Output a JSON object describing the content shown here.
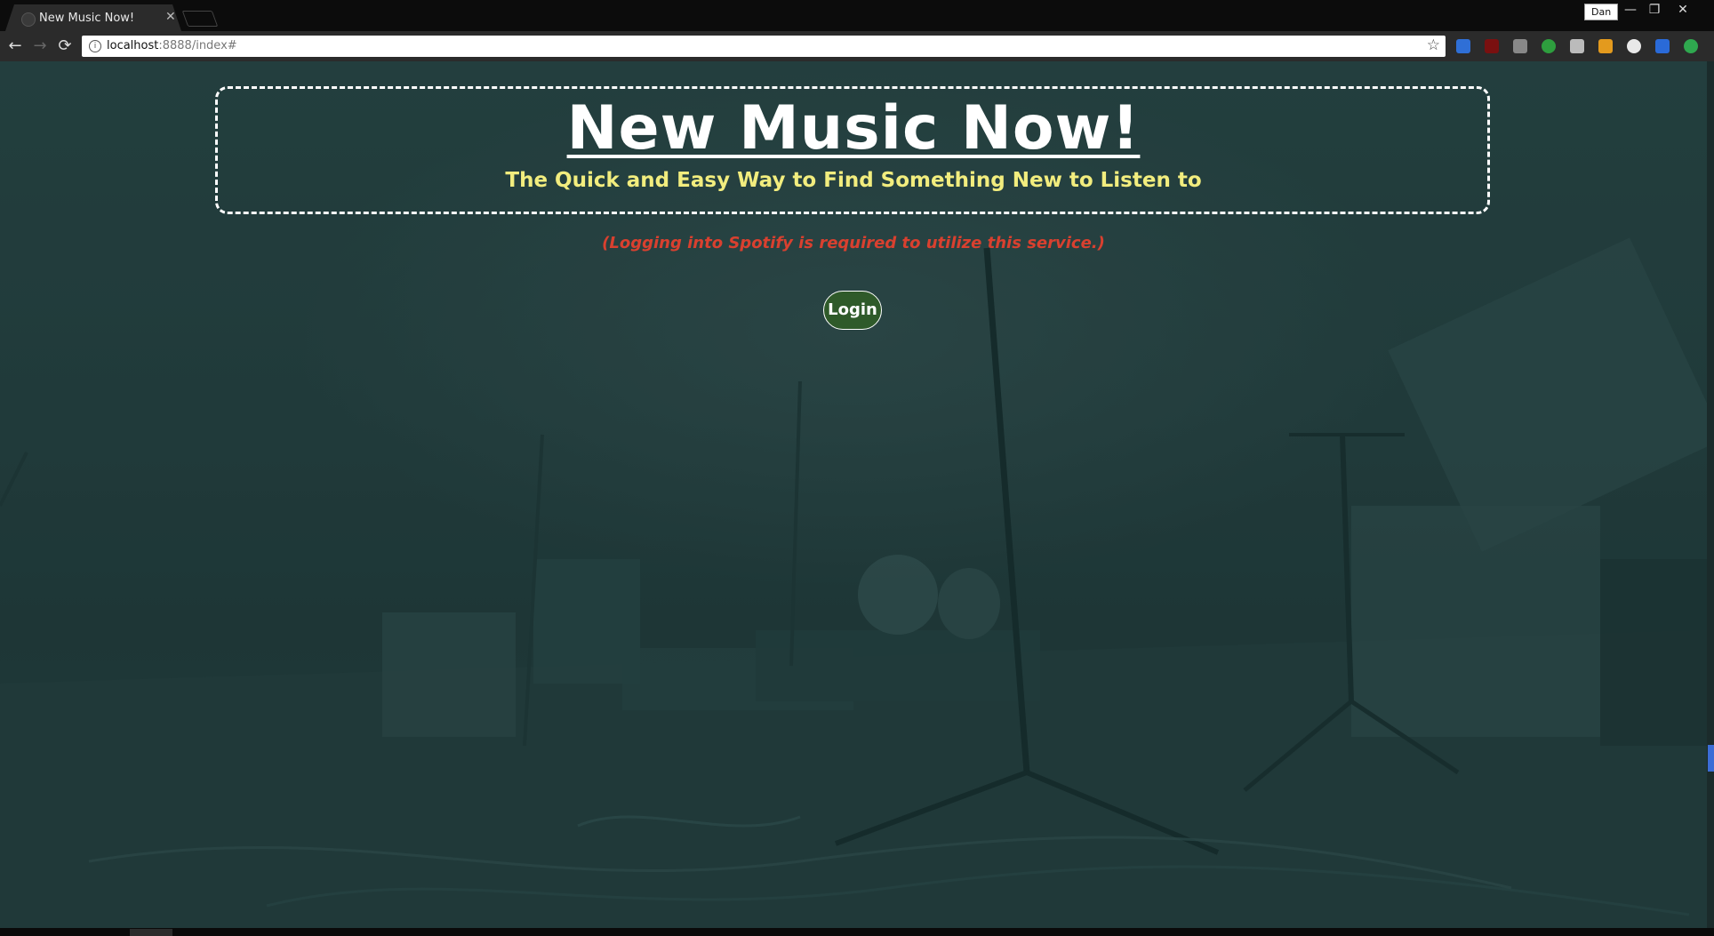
{
  "browser": {
    "tab": {
      "title": "New Music Now!",
      "close_glyph": "✕"
    },
    "profile_name": "Dan",
    "window_controls": {
      "minimize": "—",
      "restore": "❐",
      "close": "✕"
    },
    "nav": {
      "back": "←",
      "forward": "→",
      "reload": "⟳"
    },
    "address": {
      "host": "localhost",
      "path": ":8888/index#"
    },
    "bookmark_glyph": "☆",
    "extensions": [
      {
        "name": "ext-blue-icon",
        "color": "#2f6fd6"
      },
      {
        "name": "ublock-icon",
        "color": "#7a1010"
      },
      {
        "name": "ext-gray-icon",
        "color": "#888888"
      },
      {
        "name": "ext-check-icon",
        "color": "#2e9e3e"
      },
      {
        "name": "ext-shield-icon",
        "color": "#bbbbbb"
      },
      {
        "name": "ext-orange-icon",
        "color": "#e39a1e"
      },
      {
        "name": "ext-circle-icon",
        "color": "#e8e8e8"
      },
      {
        "name": "ext-s-icon",
        "color": "#2a6ad8"
      },
      {
        "name": "ext-green-up-icon",
        "color": "#2fa84f"
      }
    ]
  },
  "hero": {
    "title": "New Music Now!",
    "subtitle": "The Quick and Easy Way to Find Something New to Listen to"
  },
  "notice": "(Logging into Spotify is required to utilize this service.)",
  "login_button": "Login",
  "colors": {
    "title": "#ffffff",
    "subtitle": "#f2ed7e",
    "notice": "#d9402f",
    "button_bg": "#2f5a2a",
    "background": "#213b3b"
  }
}
